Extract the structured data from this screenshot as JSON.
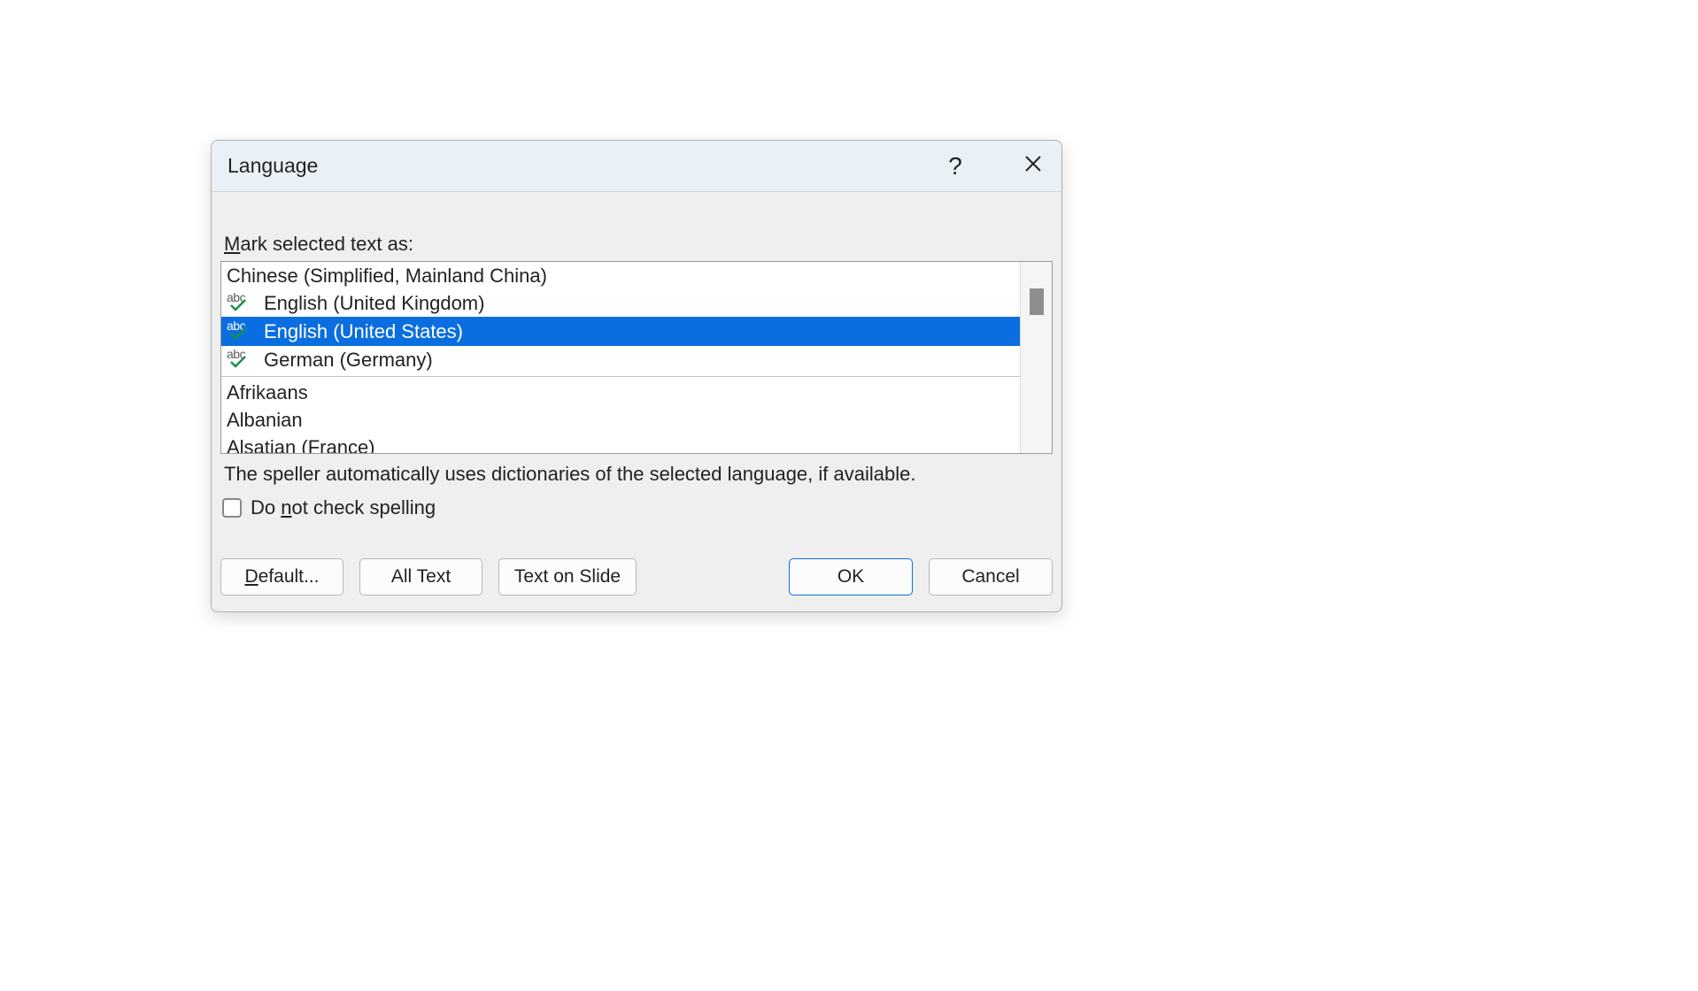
{
  "dialog": {
    "title": "Language",
    "help_glyph": "?",
    "mark_label_pre": "M",
    "mark_label_post": "ark selected text as:",
    "languages": [
      {
        "label": "Chinese (Simplified, Mainland China)",
        "has_dict": false,
        "selected": false
      },
      {
        "label": "English (United Kingdom)",
        "has_dict": true,
        "selected": false
      },
      {
        "label": "English (United States)",
        "has_dict": true,
        "selected": true
      },
      {
        "label": "German (Germany)",
        "has_dict": true,
        "selected": false
      }
    ],
    "more_languages": [
      "Afrikaans",
      "Albanian",
      "Alsatian (France)"
    ],
    "abc_text": "abc",
    "info_text": "The speller automatically uses dictionaries of the selected language, if available.",
    "checkbox": {
      "pre": "Do ",
      "u": "n",
      "post": "ot check spelling",
      "checked": false
    },
    "buttons": {
      "default_u": "D",
      "default_post": "efault...",
      "all_text": "All Text",
      "text_on_slide": "Text on Slide",
      "ok": "OK",
      "cancel": "Cancel"
    }
  }
}
